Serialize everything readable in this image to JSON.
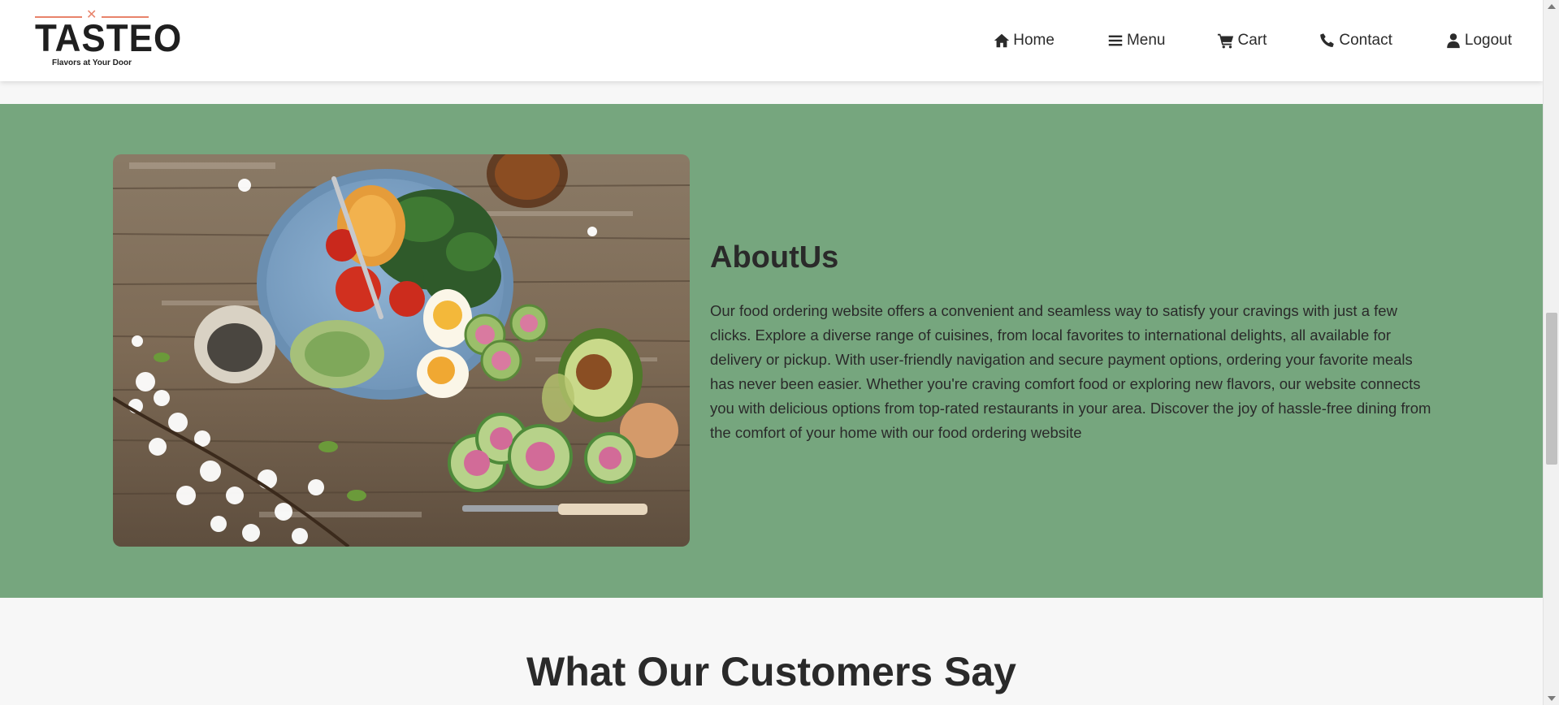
{
  "brand": {
    "name": "TASTEO",
    "tagline": "Flavors at Your Door",
    "accent_color": "#e8836b"
  },
  "nav": {
    "items": [
      {
        "label": "Home",
        "icon": "home-icon"
      },
      {
        "label": "Menu",
        "icon": "menu-icon"
      },
      {
        "label": "Cart",
        "icon": "cart-icon"
      },
      {
        "label": "Contact",
        "icon": "phone-icon"
      },
      {
        "label": "Logout",
        "icon": "user-icon"
      }
    ]
  },
  "about": {
    "title": "AboutUs",
    "text": "Our food ordering website offers a convenient and seamless way to satisfy your cravings with just a few clicks. Explore a diverse range of cuisines, from local favorites to international delights, all available for delivery or pickup. With user-friendly navigation and secure payment options, ordering your favorite meals has never been easier. Whether you're craving comfort food or exploring new flavors, our website connects you with delicious options from top-rated restaurants in your area. Discover the joy of hassle-free dining from the comfort of your home with our food ordering website",
    "background_color": "#76a67e"
  },
  "testimonials": {
    "title": "What Our Customers Say"
  }
}
